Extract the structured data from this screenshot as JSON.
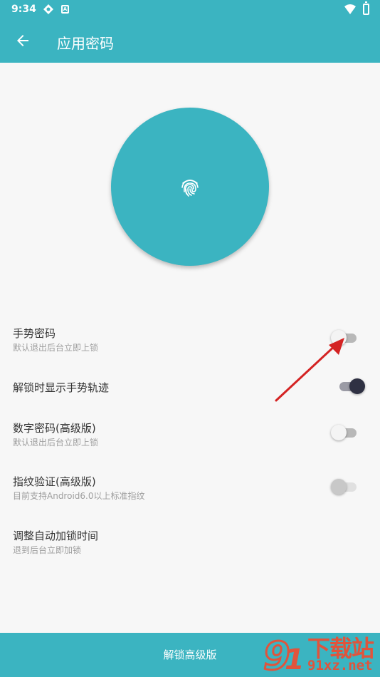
{
  "status_bar": {
    "time": "9:34",
    "notification_badge": "A"
  },
  "app_bar": {
    "title": "应用密码"
  },
  "settings": [
    {
      "label": "手势密码",
      "subtitle": "默认退出后台立即上锁",
      "switch_on": false
    },
    {
      "label": "解锁时显示手势轨迹",
      "subtitle": "",
      "switch_on": true
    },
    {
      "label": "数字密码(高级版)",
      "subtitle": "默认退出后台立即上锁",
      "switch_on": false
    },
    {
      "label": "指纹验证(高级版)",
      "subtitle": "目前支持Android6.0以上标准指纹",
      "switch_on": false
    },
    {
      "label": "调整自动加锁时间",
      "subtitle": "退到后台立即加锁"
    }
  ],
  "bottom_button": {
    "label": "解锁高级版"
  },
  "watermark": {
    "cn": "下载站",
    "url": "91xz.net"
  },
  "colors": {
    "primary": "#3bb4c1",
    "accent_arrow": "#d42323"
  }
}
